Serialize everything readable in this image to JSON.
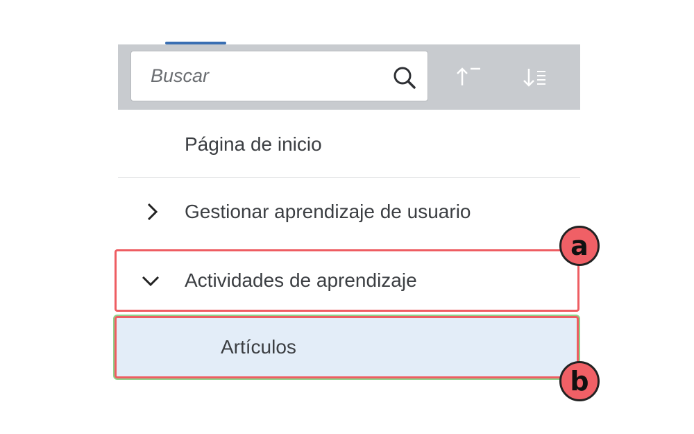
{
  "search": {
    "placeholder": "Buscar"
  },
  "toolbar": {
    "sort_asc_icon": "sort-ascending-icon",
    "sort_desc_icon": "sort-descending-icon"
  },
  "nav": {
    "items": [
      {
        "label": "Página de inicio"
      },
      {
        "label": "Gestionar aprendizaje de usuario",
        "icon": "chevron-right-icon"
      },
      {
        "label": "Actividades de aprendizaje",
        "icon": "chevron-down-icon"
      },
      {
        "label": "Artículos"
      }
    ]
  },
  "annotations": {
    "a": "a",
    "b": "b"
  },
  "colors": {
    "toolbar_bg": "#c8cbcf",
    "tab_indicator": "#3a6fb3",
    "highlight_border": "#ee5d62",
    "selected_bg": "#e3edf8",
    "selected_outline": "#8fd28b",
    "badge_fill": "#f06066"
  }
}
